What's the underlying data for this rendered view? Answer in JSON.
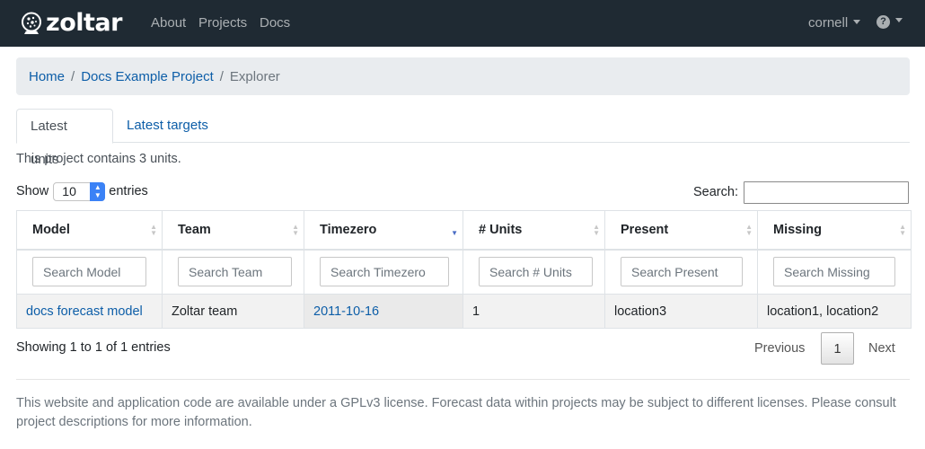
{
  "navbar": {
    "brand": "zoltar",
    "links": [
      "About",
      "Projects",
      "Docs"
    ],
    "user": "cornell",
    "help_icon": "?"
  },
  "breadcrumb": {
    "items": [
      "Home",
      "Docs Example Project"
    ],
    "active": "Explorer",
    "separator": "/"
  },
  "tabs": [
    "Latest units",
    "Latest targets"
  ],
  "summary": "This project contains 3 units.",
  "length_control": {
    "prefix": "Show",
    "value": "10",
    "suffix": "entries"
  },
  "search": {
    "label": "Search:",
    "value": ""
  },
  "table": {
    "columns": [
      "Model",
      "Team",
      "Timezero",
      "# Units",
      "Present",
      "Missing"
    ],
    "sorted_column": "Timezero",
    "filters": [
      "Search Model",
      "Search Team",
      "Search Timezero",
      "Search # Units",
      "Search Present",
      "Search Missing"
    ],
    "rows": [
      [
        "docs forecast model",
        "Zoltar team",
        "2011-10-16",
        "1",
        "location3",
        "location1, location2"
      ]
    ]
  },
  "info": "Showing 1 to 1 of 1 entries",
  "pagination": {
    "previous": "Previous",
    "current": "1",
    "next": "Next"
  },
  "footer": "This website and application code are available under a GPLv3 license. Forecast data within projects may be subject to different licenses. Please consult project descriptions for more information.",
  "colors": {
    "navbar_bg": "#1f2a33",
    "link": "#0d5ea8",
    "breadcrumb_bg": "#e9ecef",
    "row_bg": "#f2f2f2"
  }
}
